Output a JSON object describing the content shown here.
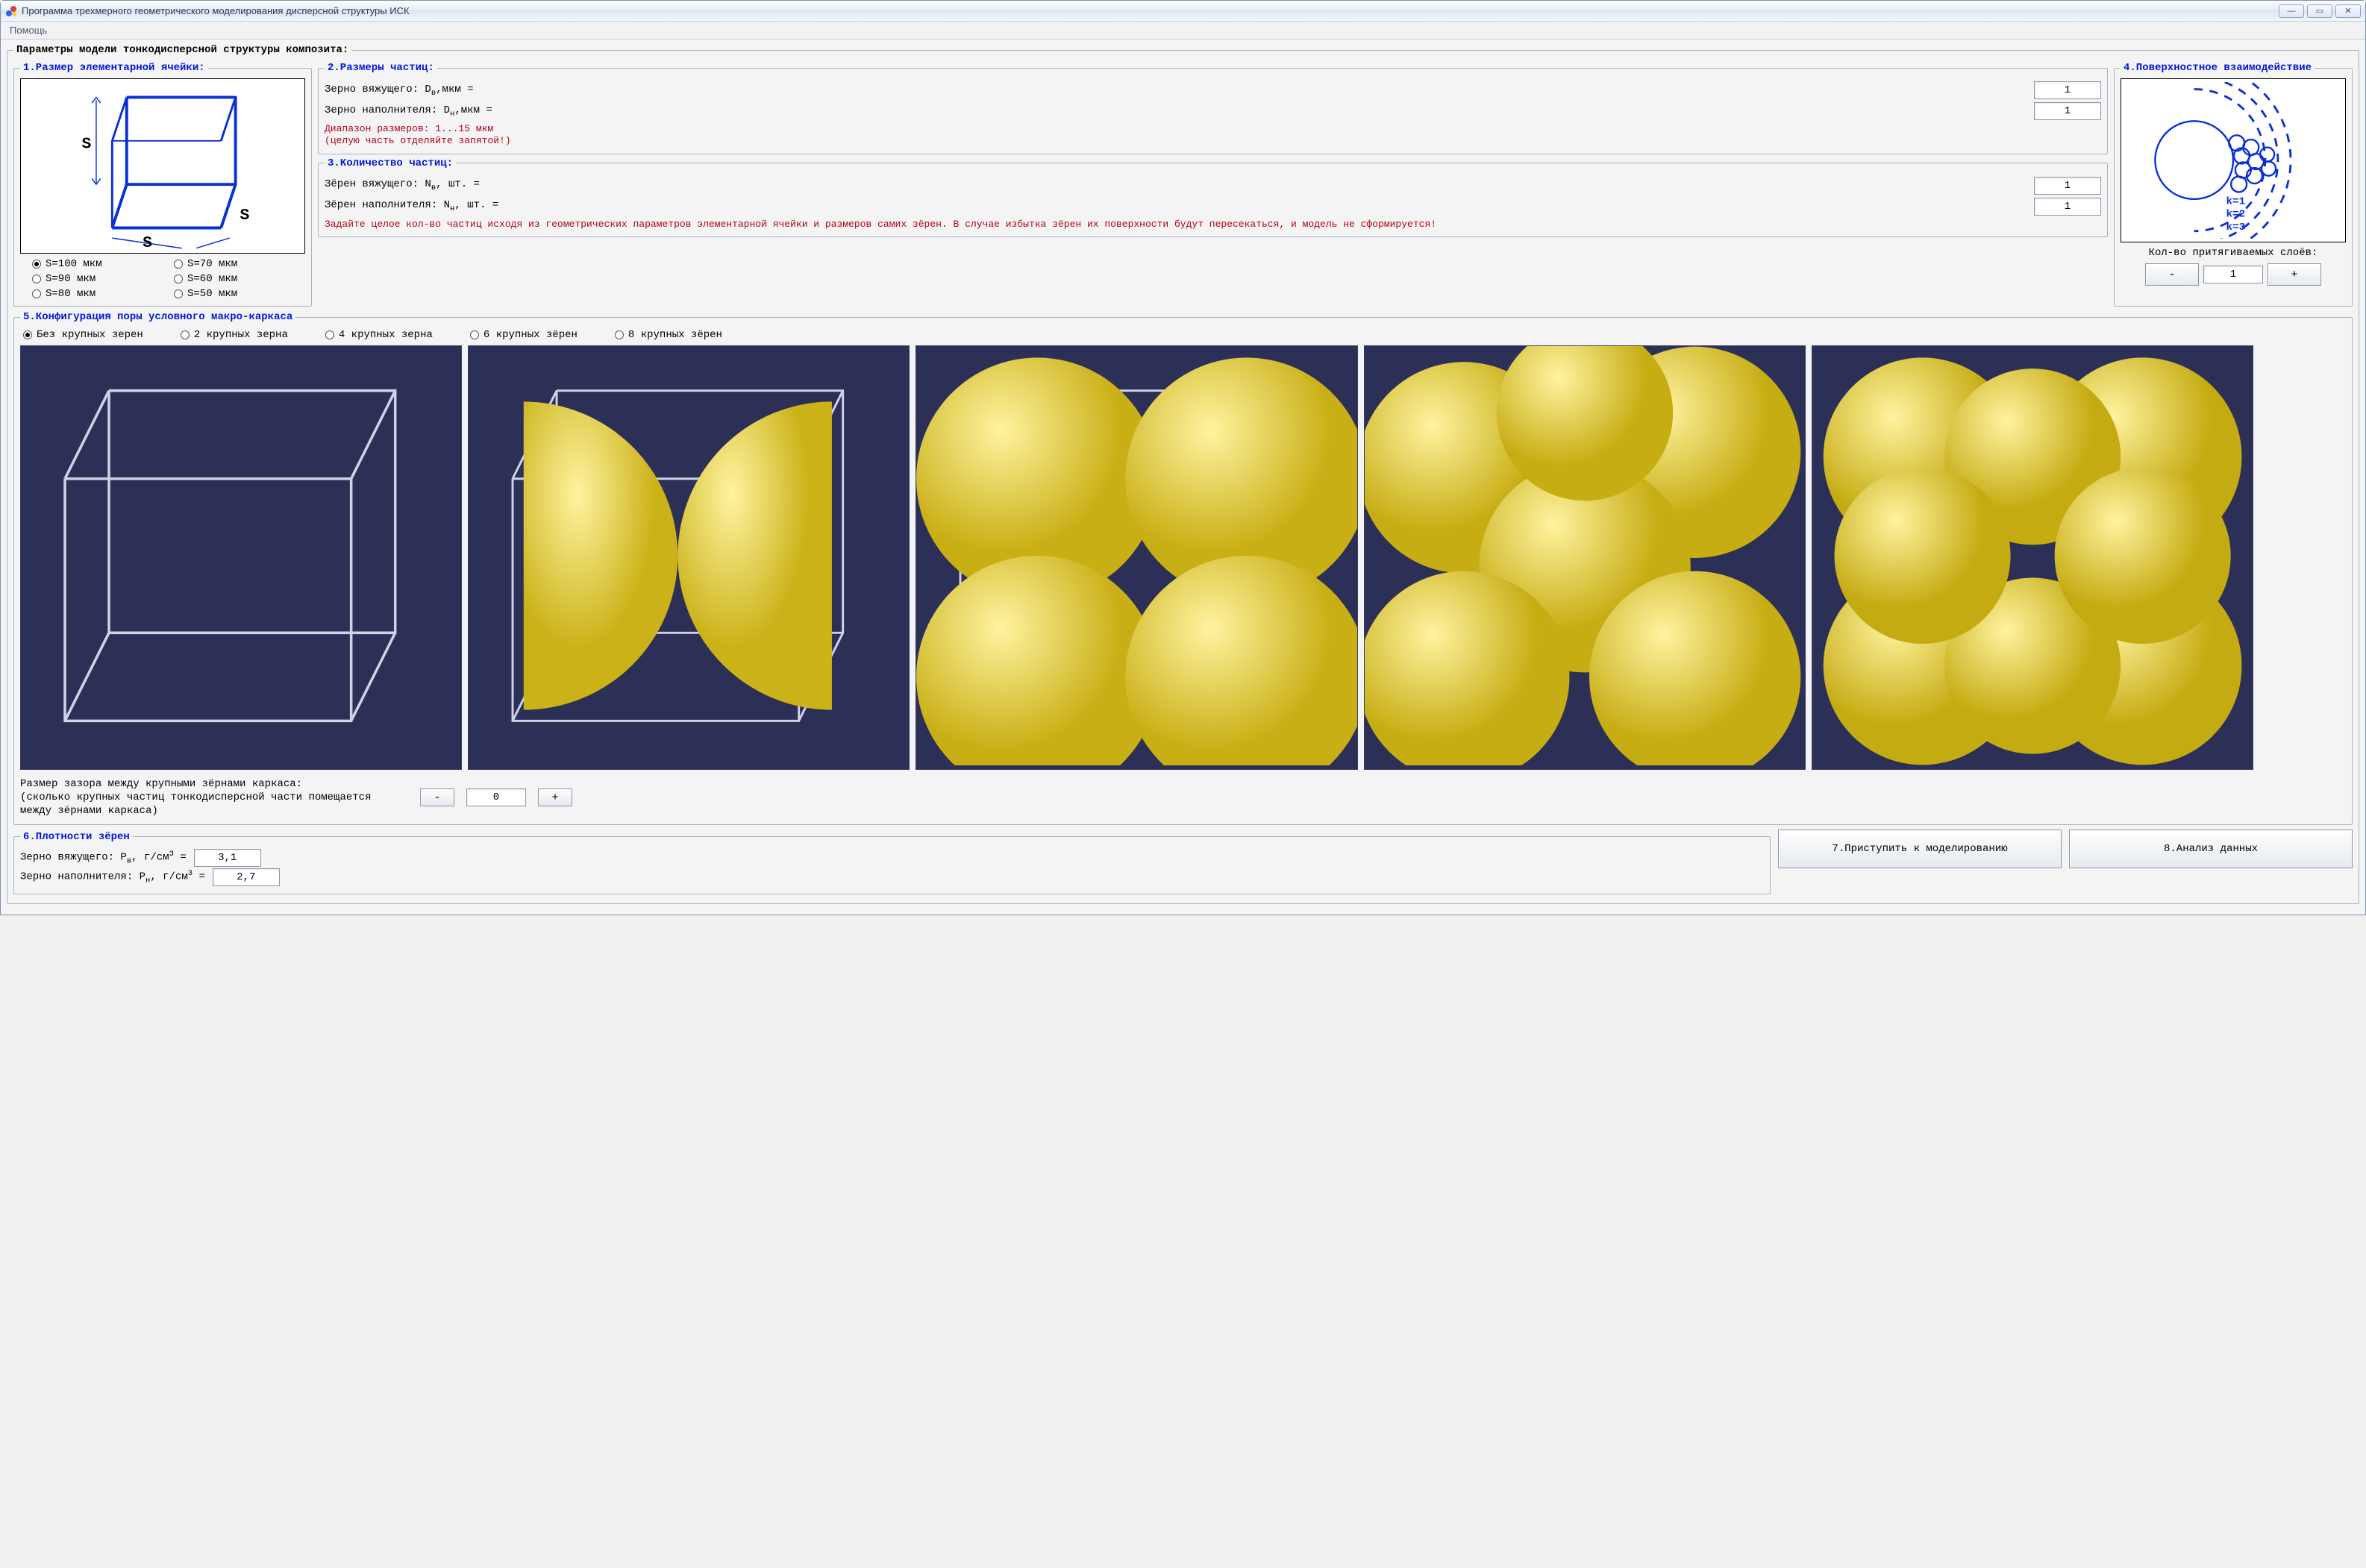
{
  "window": {
    "title": "Программа трехмерного геометрического моделирования дисперсной структуры ИСК"
  },
  "menu": {
    "help": "Помощь"
  },
  "main_legend": "Параметры модели тонкодисперсной структуры композита:",
  "sec1": {
    "legend": "1.Размер элементарной ячейки:",
    "s_label": "S",
    "options": [
      "S=100 мкм",
      "S=70 мкм",
      "S=90 мкм",
      "S=60 мкм",
      "S=80 мкм",
      "S=50 мкм"
    ],
    "selected": "S=100 мкм"
  },
  "sec2": {
    "legend": "2.Размеры частиц:",
    "row1_prefix": "Зерно вяжущего: D",
    "row1_sub": "в",
    "row1_suffix": ",мкм =",
    "row1_value": "1",
    "row2_prefix": "Зерно наполнителя: D",
    "row2_sub": "н",
    "row2_suffix": ",мкм =",
    "row2_value": "1",
    "warn": "Диапазон размеров: 1...15 мкм\n(целую часть отделяйте запятой!)"
  },
  "sec3": {
    "legend": "3.Количество частиц:",
    "row1_prefix": "Зёрен вяжущего: N",
    "row1_sub": "в",
    "row1_suffix": ", шт. =",
    "row1_value": "1",
    "row2_prefix": "Зёрен наполнителя: N",
    "row2_sub": "н",
    "row2_suffix": ", шт. =",
    "row2_value": "1",
    "warn": "Задайте целое кол-во частиц исходя из геометрических параметров элементарной ячейки и размеров самих зёрен. В случае избытка зёрен их поверхности будут пересекаться, и модель не сформируется!"
  },
  "sec4": {
    "legend": "4.Поверхностное взаимодействие",
    "k1": "k=1",
    "k2": "k=2",
    "k3": "k=3",
    "caption": "Кол-во притягиваемых слоёв:",
    "minus": "-",
    "plus": "+",
    "value": "1"
  },
  "sec5": {
    "legend": "5.Конфигурация поры условного макро-каркаса",
    "options": [
      "Без крупных зерен",
      "2 крупных зерна",
      "4 крупных зерна",
      "6 крупных зёрен",
      "8 крупных зёрен"
    ],
    "selected": "Без крупных зерен",
    "gap_text_1": "Размер зазора между крупными зёрнами каркаса:",
    "gap_text_2": "(сколько крупных частиц тонкодисперсной части помещается между зёрнами каркаса)",
    "minus": "-",
    "plus": "+",
    "gap_value": "0"
  },
  "sec6": {
    "legend": "6.Плотности зёрен",
    "row1_prefix": "Зерно вяжущего: P",
    "row1_sub": "в",
    "row1_mid": ", г/см",
    "row1_sup": "3",
    "row1_suffix": " =",
    "row1_value": "3,1",
    "row2_prefix": "Зерно наполнителя: P",
    "row2_sub": "н",
    "row2_mid": ", г/см",
    "row2_sup": "3",
    "row2_suffix": " =",
    "row2_value": "2,7"
  },
  "actions": {
    "model": "7.Приступить к моделированию",
    "analyze": "8.Анализ данных"
  }
}
